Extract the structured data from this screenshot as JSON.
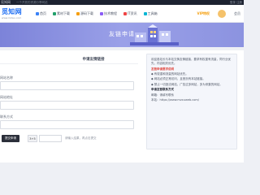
{
  "topbar": {
    "site": "觅知网",
    "subtitle": "一个开放的资源分享网站",
    "right": "登录  注册"
  },
  "nav": {
    "logo_mark": "觅知网",
    "logo_tag": "www.mzwu.com",
    "menu": [
      "首页",
      "素材下载",
      "源码下载",
      "技术教程",
      "IT资讯",
      "工具箱"
    ],
    "promo": "VIP特权",
    "user": "会员"
  },
  "banner": {
    "title": "友链申请"
  },
  "form": {
    "title": "申请友情链接",
    "fields": [
      {
        "label": "网站名称",
        "placeholder": ""
      },
      {
        "label": "网站地址",
        "placeholder": ""
      },
      {
        "label": "联系方式",
        "placeholder": ""
      }
    ],
    "submit": "提交申请",
    "captcha_code": "3+5",
    "captcha_hint": "请输入结果，再点击提交"
  },
  "sidebox": {
    "intro": "欢迎各站长与本站交换友情链接，要求有权重有流量，同行业优先，内容相关优先。",
    "rules_title": "友链申请要求说明",
    "rules": [
      "◆ 有权重和流量的网站优先。",
      "◆ 网站必须正常访问，且首页有本站链接。",
      "◆ 禁止一切违法网站，广告过多网站，多为采集的网站。"
    ],
    "contact_title": "申请友链联系方式",
    "contact": "邮箱：请填写联系",
    "url": "本站：https://www.mzxuweb.com/"
  }
}
